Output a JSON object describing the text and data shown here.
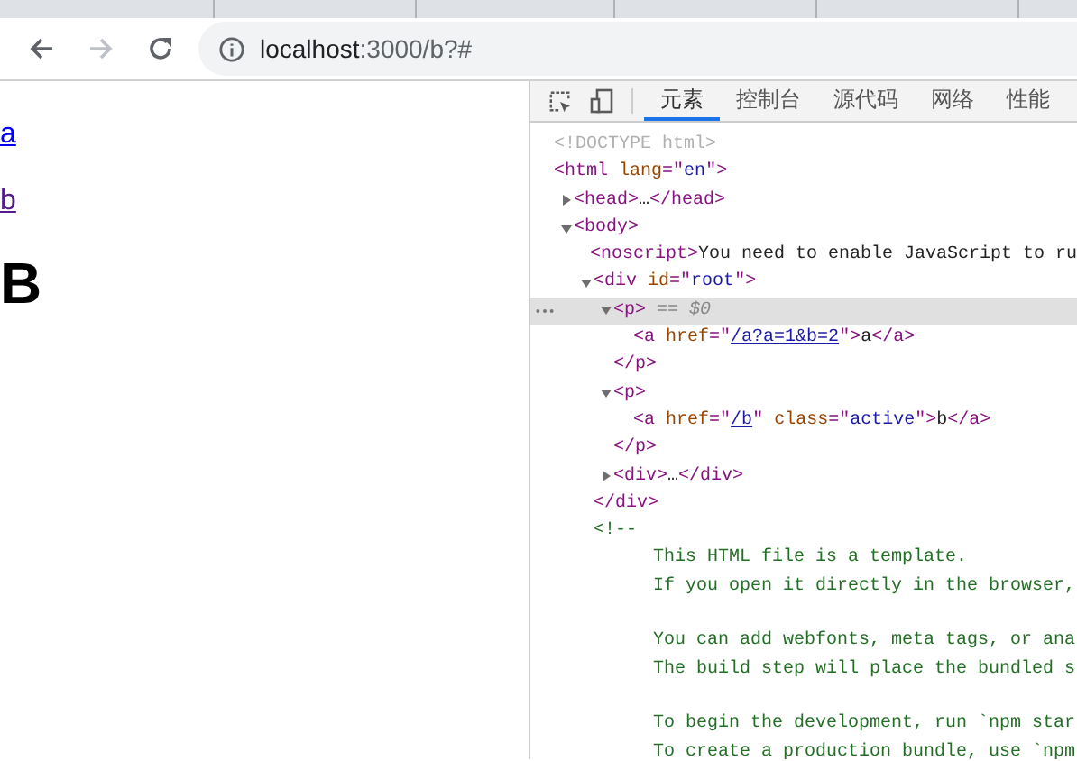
{
  "address_bar": {
    "host": "localhost",
    "path": ":3000/b?#",
    "forward_disabled": true
  },
  "page": {
    "links": [
      {
        "text": "a",
        "visited": false
      },
      {
        "text": "b",
        "visited": true
      }
    ],
    "heading": "B"
  },
  "devtools": {
    "tabs": [
      {
        "label": "元素",
        "selected": true
      },
      {
        "label": "控制台",
        "selected": false
      },
      {
        "label": "源代码",
        "selected": false
      },
      {
        "label": "网络",
        "selected": false
      },
      {
        "label": "性能",
        "selected": false
      }
    ],
    "tree": [
      {
        "selected": false,
        "open": [
          {
            "kind": "doctype",
            "text": "<!DOCTYPE html>"
          }
        ]
      },
      {
        "selected": false,
        "open": [
          {
            "kind": "tag",
            "text": "<html "
          },
          {
            "kind": "attr",
            "text": "lang"
          },
          {
            "kind": "tag",
            "text": "=\""
          },
          {
            "kind": "value",
            "text": "en"
          },
          {
            "kind": "tag",
            "text": "\">"
          }
        ],
        "children": [
          {
            "selected": false,
            "expanded": false,
            "open": [
              {
                "kind": "tag",
                "text": "<head>"
              },
              {
                "kind": "text",
                "text": "…"
              },
              {
                "kind": "tag",
                "text": "</head>"
              }
            ]
          },
          {
            "selected": false,
            "expanded": true,
            "open": [
              {
                "kind": "tag",
                "text": "<body>"
              }
            ],
            "children": [
              {
                "selected": false,
                "open": [
                  {
                    "kind": "tag",
                    "text": "<noscript>"
                  },
                  {
                    "kind": "text",
                    "text": "You need to enable JavaScript to ru"
                  }
                ]
              },
              {
                "selected": false,
                "expanded": true,
                "open": [
                  {
                    "kind": "tag",
                    "text": "<div "
                  },
                  {
                    "kind": "attr",
                    "text": "id"
                  },
                  {
                    "kind": "tag",
                    "text": "=\""
                  },
                  {
                    "kind": "value",
                    "text": "root"
                  },
                  {
                    "kind": "tag",
                    "text": "\">"
                  }
                ],
                "close": [
                  {
                    "kind": "tag",
                    "text": "</div>"
                  }
                ],
                "children": [
                  {
                    "selected": true,
                    "expanded": true,
                    "open": [
                      {
                        "kind": "tag",
                        "text": "<p>"
                      },
                      {
                        "kind": "ref",
                        "text": " == $0"
                      }
                    ],
                    "close": [
                      {
                        "kind": "tag",
                        "text": "</p>"
                      }
                    ],
                    "children": [
                      {
                        "selected": false,
                        "open": [
                          {
                            "kind": "tag",
                            "text": "<a "
                          },
                          {
                            "kind": "attr",
                            "text": "href"
                          },
                          {
                            "kind": "tag",
                            "text": "=\""
                          },
                          {
                            "kind": "link",
                            "text": "/a?a=1&b=2"
                          },
                          {
                            "kind": "tag",
                            "text": "\">"
                          },
                          {
                            "kind": "text",
                            "text": "a"
                          },
                          {
                            "kind": "tag",
                            "text": "</a>"
                          }
                        ]
                      }
                    ]
                  },
                  {
                    "selected": false,
                    "expanded": true,
                    "open": [
                      {
                        "kind": "tag",
                        "text": "<p>"
                      }
                    ],
                    "close": [
                      {
                        "kind": "tag",
                        "text": "</p>"
                      }
                    ],
                    "children": [
                      {
                        "selected": false,
                        "open": [
                          {
                            "kind": "tag",
                            "text": "<a "
                          },
                          {
                            "kind": "attr",
                            "text": "href"
                          },
                          {
                            "kind": "tag",
                            "text": "=\""
                          },
                          {
                            "kind": "link",
                            "text": "/b"
                          },
                          {
                            "kind": "tag",
                            "text": "\" "
                          },
                          {
                            "kind": "attr",
                            "text": "class"
                          },
                          {
                            "kind": "tag",
                            "text": "=\""
                          },
                          {
                            "kind": "value",
                            "text": "active"
                          },
                          {
                            "kind": "tag",
                            "text": "\">"
                          },
                          {
                            "kind": "text",
                            "text": "b"
                          },
                          {
                            "kind": "tag",
                            "text": "</a>"
                          }
                        ]
                      }
                    ]
                  },
                  {
                    "selected": false,
                    "expanded": false,
                    "open": [
                      {
                        "kind": "tag",
                        "text": "<div>"
                      },
                      {
                        "kind": "text",
                        "text": "…"
                      },
                      {
                        "kind": "tag",
                        "text": "</div>"
                      }
                    ]
                  }
                ]
              },
              {
                "selected": false,
                "open": [
                  {
                    "kind": "comment",
                    "text": "<!--"
                  }
                ],
                "comment_lines": [
                  {
                    "text": "This HTML file is a template.",
                    "blank_before": false
                  },
                  {
                    "text": "If you open it directly in the browser,",
                    "blank_before": false
                  },
                  {
                    "text": "You can add webfonts, meta tags, or ana",
                    "blank_before": true
                  },
                  {
                    "text": "The build step will place the bundled s",
                    "blank_before": false
                  },
                  {
                    "text": "To begin the development, run `npm star",
                    "blank_before": true
                  },
                  {
                    "text": "To create a production bundle, use `npm",
                    "blank_before": false
                  }
                ]
              }
            ]
          }
        ]
      }
    ]
  }
}
